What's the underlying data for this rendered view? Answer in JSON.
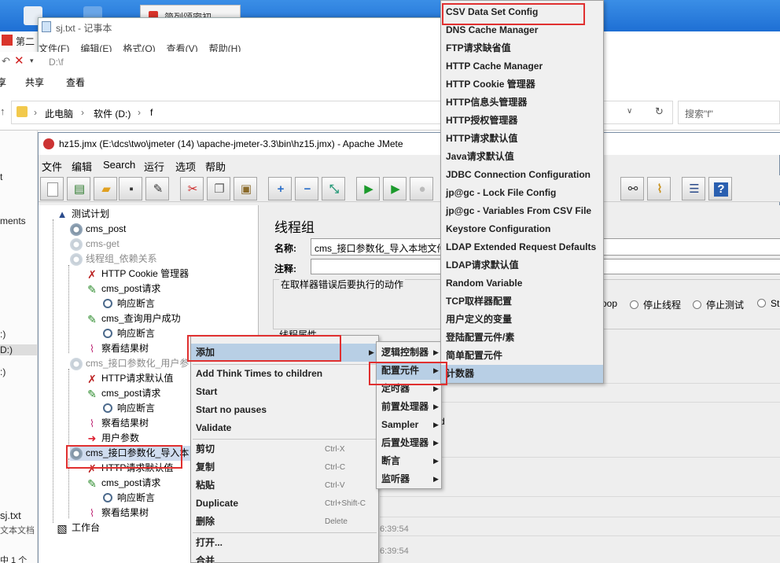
{
  "notepad": {
    "title": "sj.txt - 记事本",
    "menu": [
      "文件(F)",
      "编辑(E)",
      "格式(O)",
      "查看(V)",
      "帮助(H)"
    ]
  },
  "browser_tab": "第二",
  "browser_tab2": "简列颂密初",
  "explorer": {
    "path_title": "D:\\f",
    "tabs": [
      "享",
      "共享",
      "查看"
    ],
    "crumbs": [
      "此电脑",
      "软件 (D:)",
      "f"
    ],
    "search_placeholder": "搜索\"f\""
  },
  "left_strip": {
    "items": [
      "t",
      "ments",
      ":)",
      "D:)",
      ":)",
      "sj.txt",
      "文本文档",
      "中 1 个"
    ]
  },
  "jmeter": {
    "title": "hz15.jmx (E:\\dcs\\two\\jmeter  (14)  \\apache-jmeter-3.3\\bin\\hz15.jmx) - Apache JMete",
    "menu": [
      "文件",
      "编辑",
      "Search",
      "运行",
      "选项",
      "帮助"
    ],
    "tree": {
      "root": "测试计划",
      "n1": "cms_post",
      "n2": "cms-get",
      "n3": "线程组_依赖关系",
      "n3a": "HTTP Cookie 管理器",
      "n3b": "cms_post请求",
      "n3b1": "响应断言",
      "n3c": "cms_查询用户成功",
      "n3c1": "响应断言",
      "n3d": "察看结果树",
      "n4": "cms_接口参数化_用户参",
      "n4a": "HTTP请求默认值",
      "n4b": "cms_post请求",
      "n4b1": "响应断言",
      "n4c": "察看结果树",
      "n4d": "用户参数",
      "n5": "cms_接口参数化_导入本",
      "n5a": "HTTP请求默认值",
      "n5b": "cms_post请求",
      "n5b1": "响应断言",
      "n5c": "察看结果树",
      "workbench": "工作台"
    },
    "panel": {
      "title": "线程组",
      "name_label": "名称:",
      "name_value": "cms_接口参数化_导入本地文件",
      "comment_label": "注释:",
      "error_label": "在取样器错误后要执行的动作",
      "radio_loop": "oop",
      "radio_stop_thread": "停止线程",
      "radio_stop_test": "停止测试",
      "radio_st": "St",
      "thread_props": "线程属性",
      "d": "d",
      "ts1": "6:39:54",
      "ts2": "6:39:54"
    }
  },
  "context_menu": {
    "add": "添加",
    "think": "Add Think Times to children",
    "start": "Start",
    "start_no_pauses": "Start no pauses",
    "validate": "Validate",
    "cut": "剪切",
    "cut_sc": "Ctrl-X",
    "copy": "复制",
    "copy_sc": "Ctrl-C",
    "paste": "粘贴",
    "paste_sc": "Ctrl-V",
    "duplicate": "Duplicate",
    "duplicate_sc": "Ctrl+Shift-C",
    "delete": "删除",
    "delete_sc": "Delete",
    "open": "打开...",
    "merge": "合并"
  },
  "submenu_add": [
    "逻辑控制器",
    "配置元件",
    "定时器",
    "前置处理器",
    "Sampler",
    "后置处理器",
    "断言",
    "监听器"
  ],
  "submenu_config": [
    "CSV Data Set Config",
    "DNS Cache Manager",
    "FTP请求缺省值",
    "HTTP Cache Manager",
    "HTTP Cookie 管理器",
    "HTTP信息头管理器",
    "HTTP授权管理器",
    "HTTP请求默认值",
    "Java请求默认值",
    "JDBC Connection Configuration",
    "jp@gc - Lock File Config",
    "jp@gc - Variables From CSV File",
    "Keystore Configuration",
    "LDAP Extended Request Defaults",
    "LDAP请求默认值",
    "Random Variable",
    "TCP取样器配置",
    "用户定义的变量",
    "登陆配置元件/素",
    "简单配置元件",
    "计数器"
  ],
  "colors": {
    "highlight_red": "#e03030",
    "menu_highlight": "#b8cfe5",
    "title_blue": "#1e6fd4"
  }
}
